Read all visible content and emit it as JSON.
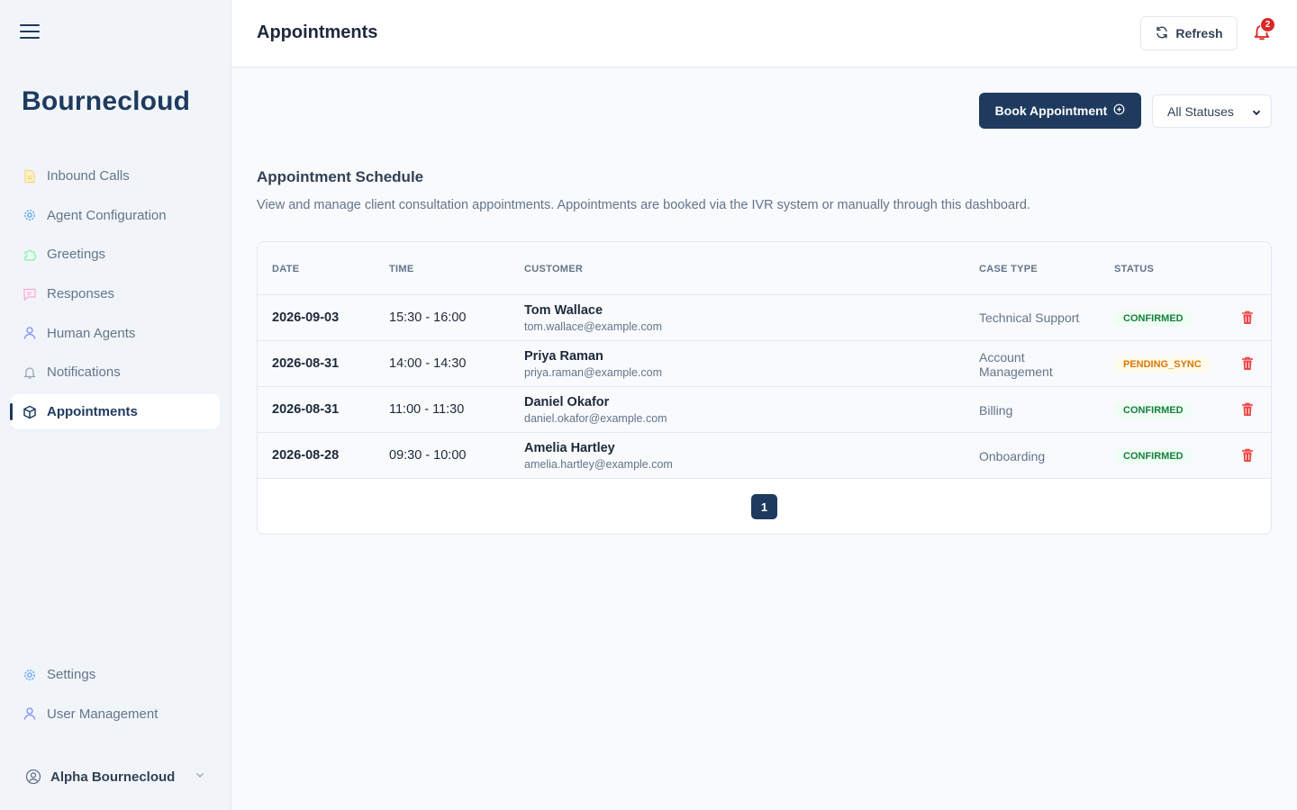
{
  "app": {
    "brand": "Bournecloud"
  },
  "sidebar": {
    "items": [
      {
        "label": "Inbound Calls",
        "icon": "document-icon"
      },
      {
        "label": "Agent Configuration",
        "icon": "gear-icon"
      },
      {
        "label": "Greetings",
        "icon": "puzzle-icon"
      },
      {
        "label": "Responses",
        "icon": "chat-icon"
      },
      {
        "label": "Human Agents",
        "icon": "user-icon"
      },
      {
        "label": "Notifications",
        "icon": "bell-icon"
      },
      {
        "label": "Appointments",
        "icon": "cube-icon",
        "active": true
      }
    ],
    "bottom_items": [
      {
        "label": "Settings",
        "icon": "gear-icon"
      },
      {
        "label": "User Management",
        "icon": "user-icon"
      }
    ],
    "user": {
      "name": "Alpha Bournecloud"
    }
  },
  "header": {
    "title": "Appointments",
    "refresh_label": "Refresh",
    "notification_count": "2"
  },
  "toolbar": {
    "book_label": "Book Appointment",
    "status_filter": "All Statuses"
  },
  "section": {
    "title": "Appointment Schedule",
    "description": "View and manage client consultation appointments. Appointments are booked via the IVR system or manually through this dashboard."
  },
  "table": {
    "columns": [
      "DATE",
      "TIME",
      "CUSTOMER",
      "CASE TYPE",
      "STATUS"
    ],
    "rows": [
      {
        "date": "2026-09-03",
        "time": "15:30 - 16:00",
        "name": "Tom Wallace",
        "email": "tom.wallace@example.com",
        "case": "Technical Support",
        "status": "CONFIRMED"
      },
      {
        "date": "2026-08-31",
        "time": "14:00 - 14:30",
        "name": "Priya Raman",
        "email": "priya.raman@example.com",
        "case": "Account Management",
        "status": "PENDING_SYNC"
      },
      {
        "date": "2026-08-31",
        "time": "11:00 - 11:30",
        "name": "Daniel Okafor",
        "email": "daniel.okafor@example.com",
        "case": "Billing",
        "status": "CONFIRMED"
      },
      {
        "date": "2026-08-28",
        "time": "09:30 - 10:00",
        "name": "Amelia Hartley",
        "email": "amelia.hartley@example.com",
        "case": "Onboarding",
        "status": "CONFIRMED"
      }
    ]
  },
  "pagination": {
    "current": "1"
  },
  "colors": {
    "brand": "#1e3a5f",
    "delete": "#ef4444",
    "confirmed": "#15803d",
    "pending": "#d97706",
    "notification": "#dc2626"
  }
}
